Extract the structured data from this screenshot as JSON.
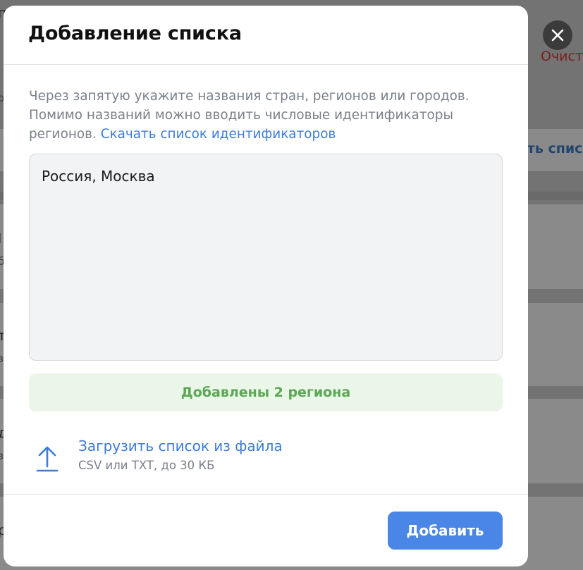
{
  "background": {
    "clear_label": "Очисти",
    "download_list_label": "ать списк",
    "fragments": [
      "п",
      "о",
      "l",
      "б",
      "т",
      "з",
      "д",
      "з",
      "р"
    ]
  },
  "modal": {
    "title": "Добавление списка",
    "hint": "Через запятую укажите названия стран, регионов или городов. Помимо названий можно вводить числовые идентификаторы регионов.",
    "hint_link": "Скачать список идентификаторов",
    "textarea_value": "Россия, Москва",
    "status": "Добавлены 2 региона",
    "upload": {
      "label": "Загрузить список из файла",
      "caption": "CSV или TXT, до 30 КБ"
    },
    "submit_label": "Добавить"
  },
  "colors": {
    "accent": "#4a86e5",
    "link": "#3c7bd8",
    "success_text": "#5aa854",
    "success_bg": "#e9f6e8",
    "overlay": "#737373"
  },
  "icons": {
    "close": "close-icon",
    "upload": "upload-icon"
  }
}
